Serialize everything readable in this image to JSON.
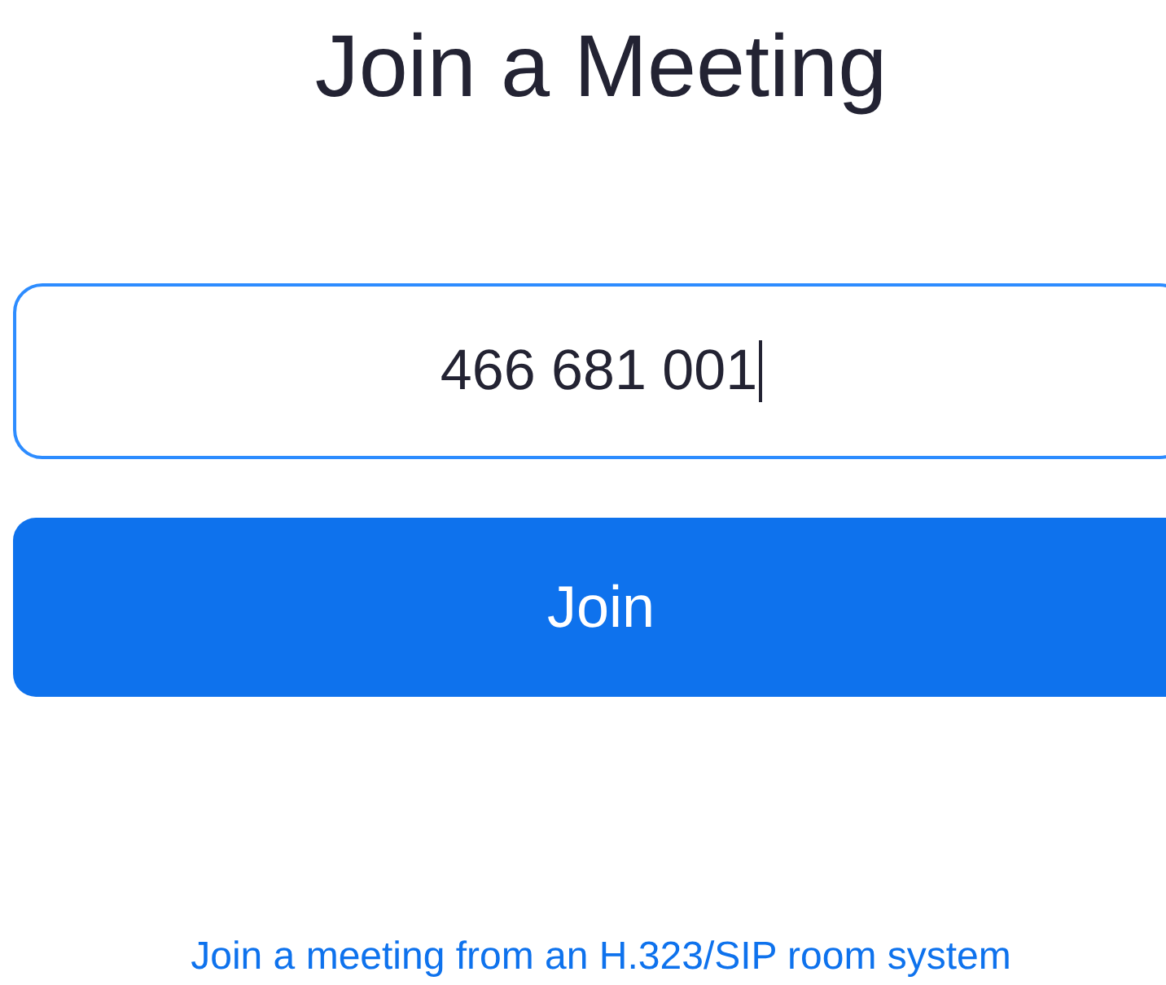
{
  "title": "Join a Meeting",
  "meeting_id_field": {
    "value": "466 681 001"
  },
  "join_button": {
    "label": "Join"
  },
  "room_system_link": {
    "label": "Join a meeting from an H.323/SIP room system"
  }
}
